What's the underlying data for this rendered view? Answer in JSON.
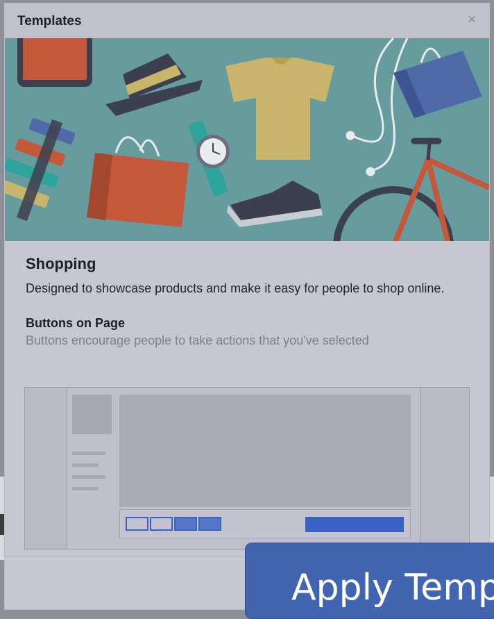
{
  "modal": {
    "title": "Templates",
    "close_glyph": "×"
  },
  "template": {
    "name": "Shopping",
    "description": "Designed to showcase products and make it easy for people to shop online."
  },
  "buttons_section": {
    "title": "Buttons on Page",
    "description": "Buttons encourage people to take actions that you've selected"
  },
  "apply_button": {
    "label": "Apply Temp"
  },
  "hero_icons": [
    "picture-frame-icon",
    "hat-icon",
    "t-shirt-icon",
    "headphones-icon",
    "shopping-bag-icon",
    "watch-icon",
    "paint-swatches-icon",
    "sneaker-icon",
    "bicycle-icon"
  ],
  "colors": {
    "hero_background": "#679c9f",
    "accent_blue": "#3a62c4",
    "button_blue": "#4265b1"
  }
}
